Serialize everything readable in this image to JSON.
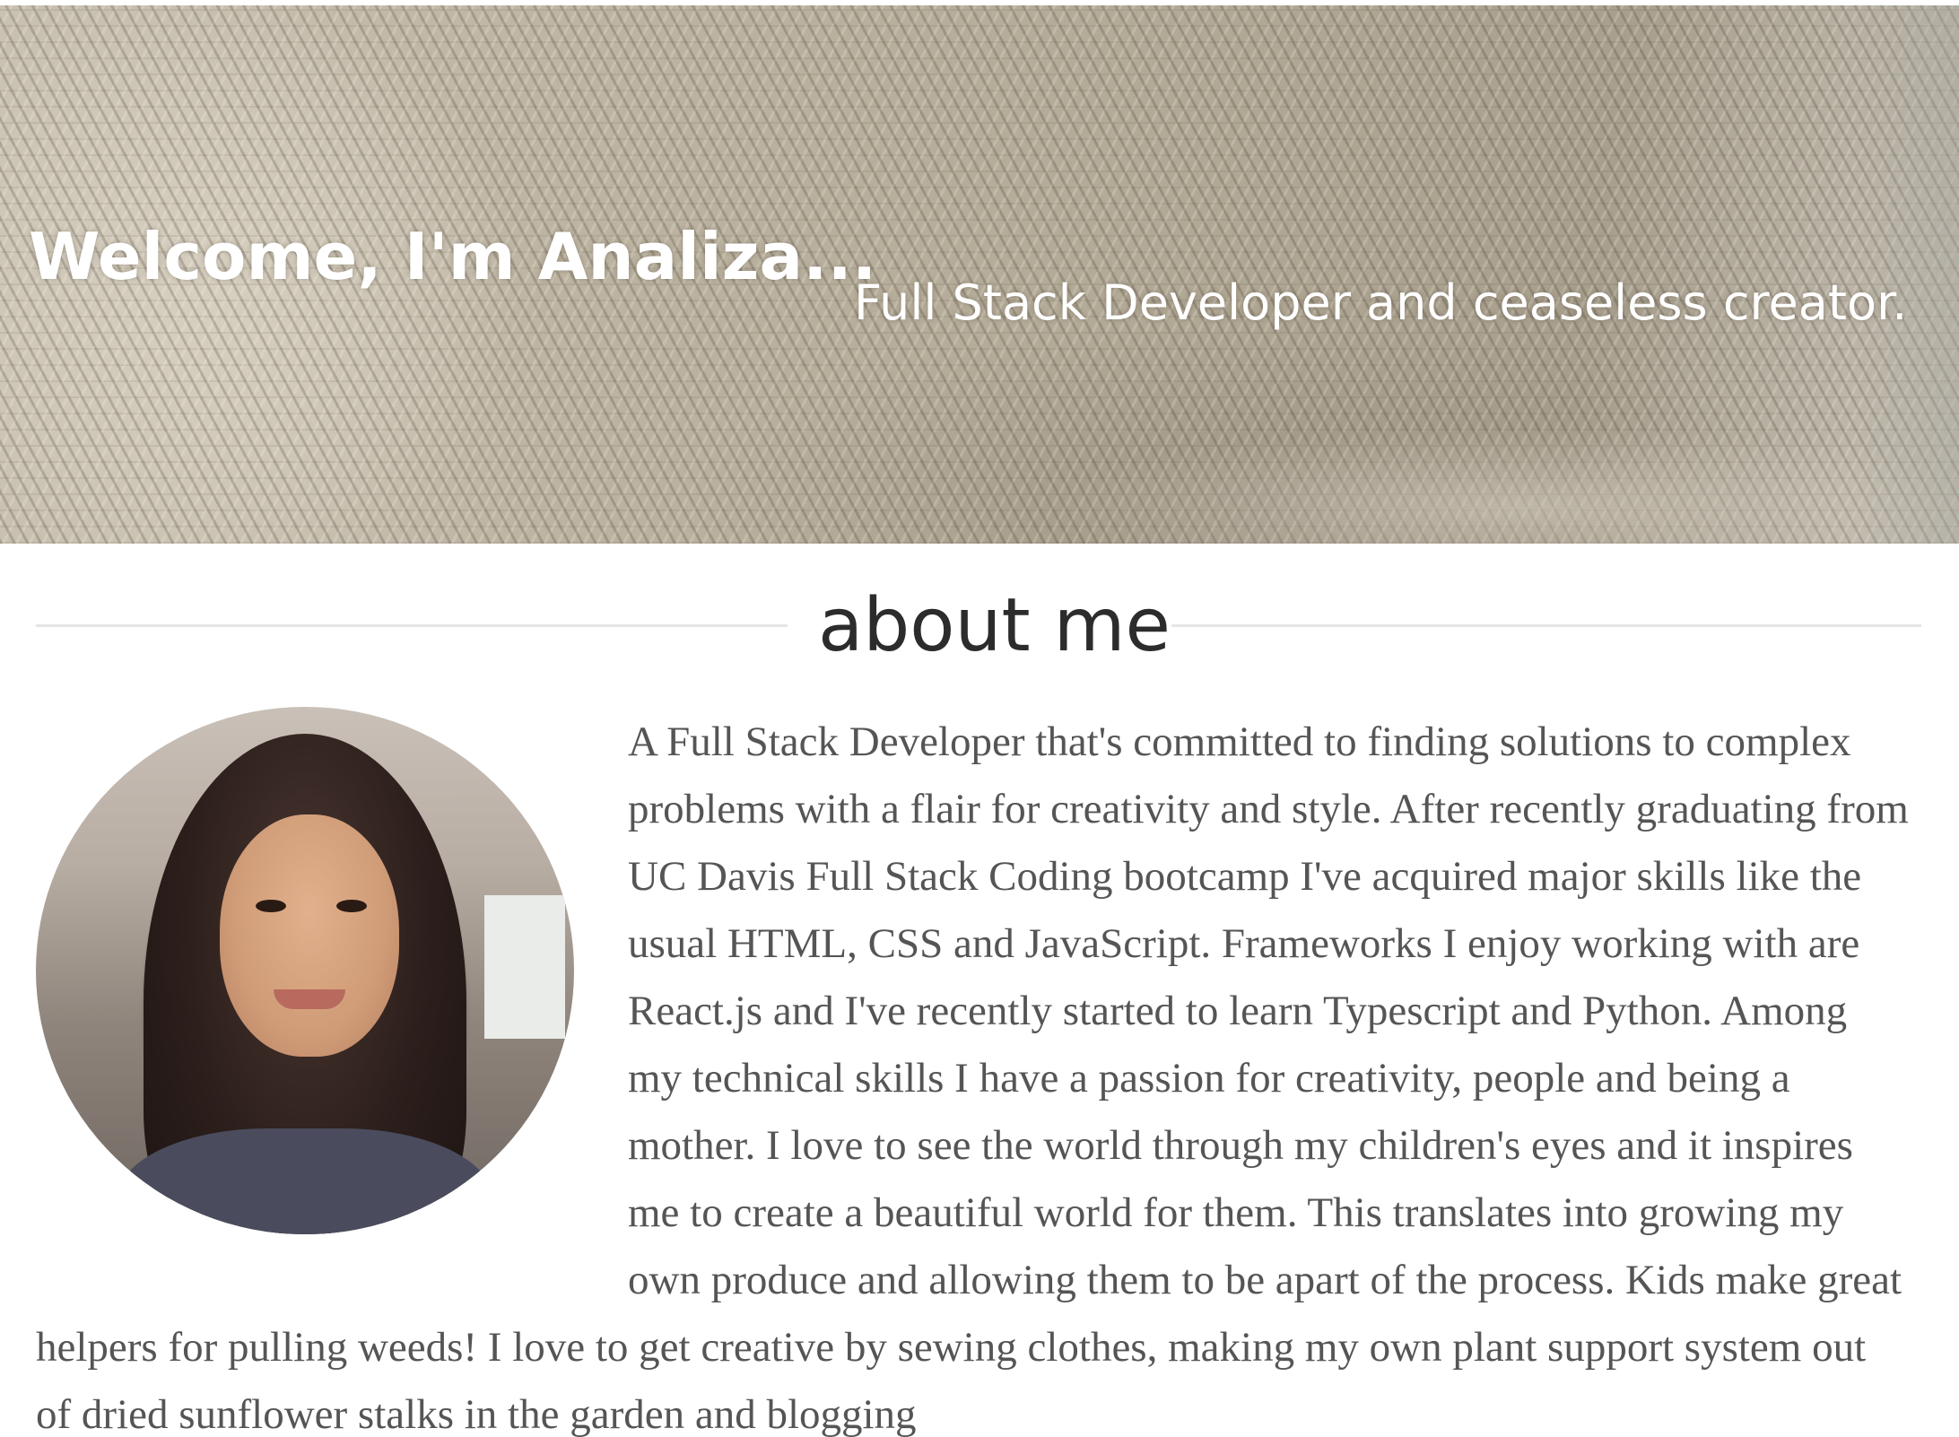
{
  "hero": {
    "title": "Welcome, I'm Analiza...",
    "subtitle": "Full Stack Developer and ceaseless creator."
  },
  "about": {
    "heading": "about me",
    "body": "A Full Stack Developer that's committed to finding solutions to complex problems with a flair for creativity and style. After recently graduating from UC Davis Full Stack Coding bootcamp I've acquired major skills like the usual HTML, CSS and JavaScript. Frameworks I enjoy working with are React.js and I've recently started to learn Typescript and Python. Among my technical skills I have a passion for creativity, people and being a mother. I love to see the world through my children's eyes and it inspires me to create a beautiful world for them. This translates into growing my own produce and allowing them to be apart of the process. Kids make great helpers for pulling weeds! I love to get creative by sewing clothes, making my own plant support system out of dried sunflower stalks in the garden and blogging"
  },
  "colors": {
    "hero_text": "#ffffff",
    "heading_text": "#2c2c2c",
    "body_text": "#555555",
    "divider": "#e6e6e6"
  }
}
